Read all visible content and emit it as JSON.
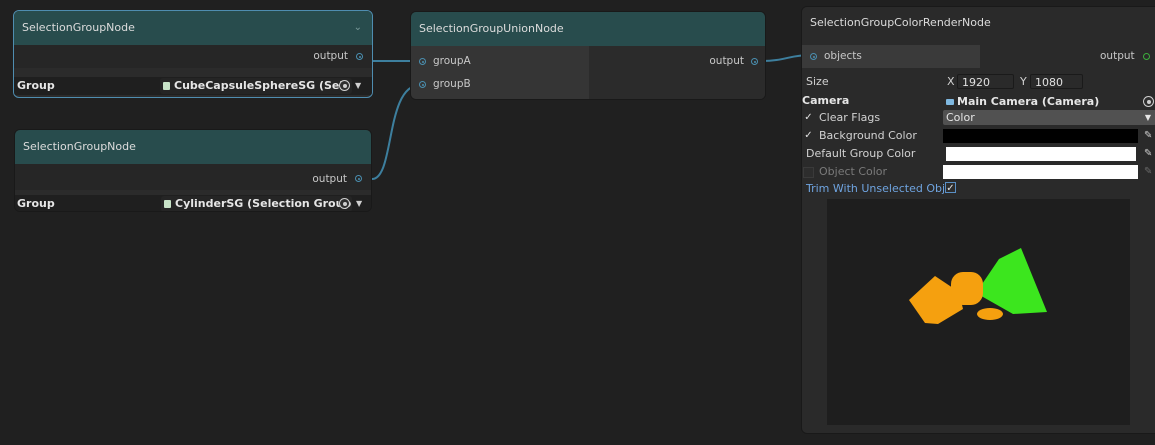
{
  "colors": {
    "canvas": "#202020",
    "node_body": "#2b2b2b",
    "node_header": "#284c4d",
    "edge": "#3d7f9e",
    "selection_outline": "#4f8db0",
    "shape_orange": "#f5a00f",
    "shape_green": "#3ce61e",
    "link_blue": "#6fa4e0"
  },
  "node_a": {
    "title": "SelectionGroupNode",
    "collapse_icon": "chevron-down-icon",
    "output_label": "output",
    "group_label": "Group",
    "group_value": "CubeCapsuleSphereSG (Sel"
  },
  "node_b": {
    "title": "SelectionGroupNode",
    "output_label": "output",
    "group_label": "Group",
    "group_value": "CylinderSG (Selection Group"
  },
  "union_node": {
    "title": "SelectionGroupUnionNode",
    "input_a": "groupA",
    "input_b": "groupB",
    "output_label": "output"
  },
  "render_node": {
    "title": "SelectionGroupColorRenderNode",
    "input_label": "objects",
    "output_label": "output",
    "size_label": "Size",
    "size_x_label": "X",
    "size_x_value": "1920",
    "size_y_label": "Y",
    "size_y_value": "1080",
    "camera_label": "Camera",
    "camera_value": "Main Camera (Camera)",
    "clear_flags_label": "Clear Flags",
    "clear_flags_value": "Color",
    "background_color_label": "Background Color",
    "default_group_color_label": "Default Group Color",
    "object_color_label": "Object Color",
    "trim_label": "Trim With Unselected Objs",
    "check_glyph": "✓"
  }
}
